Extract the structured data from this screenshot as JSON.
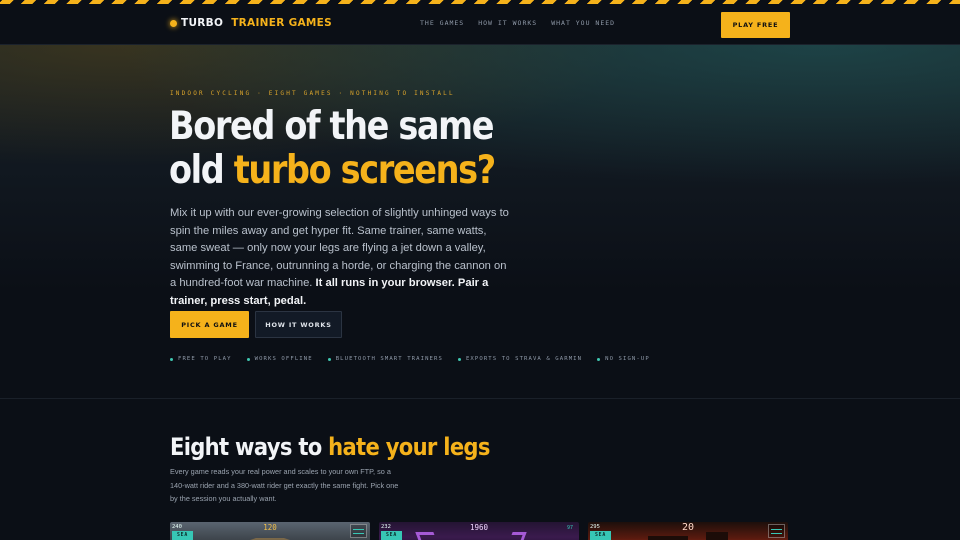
{
  "brand": {
    "part1": "TURBO",
    "part2": "TRAINER GAMES"
  },
  "nav": [
    "THE GAMES",
    "HOW IT WORKS",
    "WHAT YOU NEED"
  ],
  "header_cta": "PLAY FREE",
  "hero": {
    "eyebrow": "INDOOR CYCLING · EIGHT GAMES · NOTHING TO INSTALL",
    "title_line1": "Bored of the same",
    "title_line2_plain": "old ",
    "title_line2_accent": "turbo screens?",
    "lead": "Mix it up with our ever-growing selection of slightly unhinged ways to spin the miles away and get hyper fit. Same trainer, same watts, same sweat — only now your legs are flying a jet down a valley, swimming to France, outrunning a horde, or charging the cannon on a hundred-foot war machine.",
    "lead_strong": "It all runs in your browser. Pair a trainer, press start, pedal.",
    "primary_button": "PICK A GAME",
    "secondary_button": "HOW IT WORKS",
    "features": [
      "FREE TO PLAY",
      "WORKS OFFLINE",
      "BLUETOOTH SMART TRAINERS",
      "EXPORTS TO STRAVA & GARMIN",
      "NO SIGN-UP"
    ]
  },
  "games_section": {
    "title_plain": "Eight ways to ",
    "title_accent": "hate your legs",
    "subtitle": "Every game reads your real power and scales to your own FTP, so a 140-watt rider and a 380-watt rider get exactly the same fight. Pick one by the session you actually want.",
    "cards": [
      {
        "power": "240",
        "tag": "SEA",
        "center": "120",
        "hud": ""
      },
      {
        "power": "232",
        "tag": "SEA",
        "center": "1960",
        "hud": "97"
      },
      {
        "power": "295",
        "tag": "SEA",
        "center": "20",
        "hud": ""
      }
    ]
  },
  "colors": {
    "accent": "#f5b21b",
    "teal": "#37c7b5",
    "background": "#0b0f16"
  }
}
